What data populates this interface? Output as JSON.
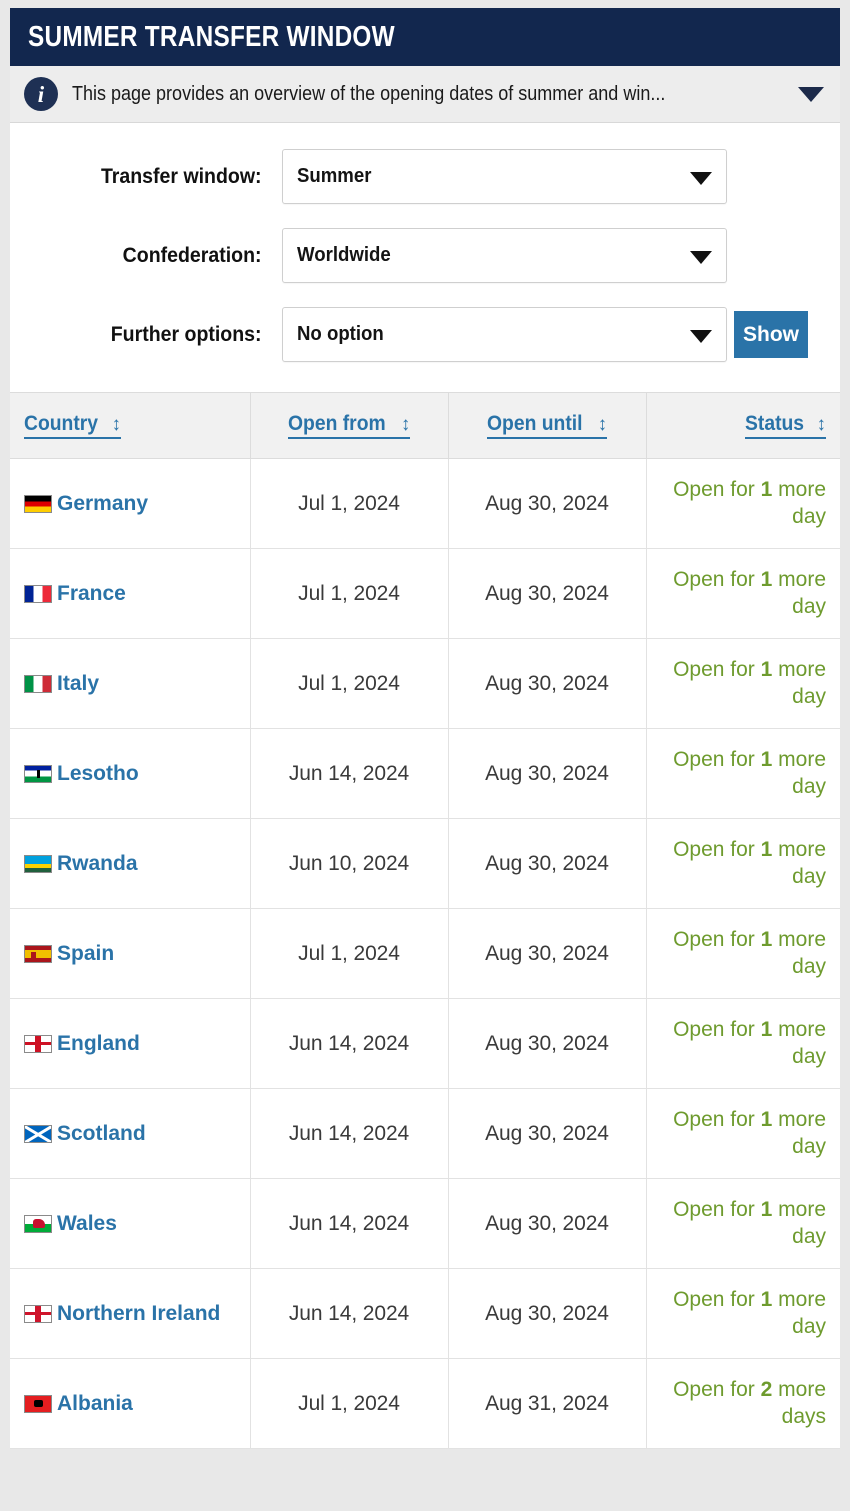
{
  "header": {
    "title": "SUMMER TRANSFER WINDOW"
  },
  "info_bar": {
    "icon": "info-icon",
    "text": "This page provides an overview of the opening dates of summer and win...",
    "expand_icon": "chevron-down-icon"
  },
  "filters": {
    "transfer_window": {
      "label": "Transfer window:",
      "value": "Summer"
    },
    "confederation": {
      "label": "Confederation:",
      "value": "Worldwide"
    },
    "further_options": {
      "label": "Further options:",
      "value": "No option"
    },
    "show_button": "Show"
  },
  "table": {
    "columns": [
      {
        "label": "Country",
        "sort_icon": "↕"
      },
      {
        "label": "Open from",
        "sort_icon": "↕"
      },
      {
        "label": "Open until",
        "sort_icon": "↕"
      },
      {
        "label": "Status",
        "sort_icon": "↕"
      }
    ],
    "rows": [
      {
        "country": "Germany",
        "flag": "f-de",
        "open_from": "Jul 1, 2024",
        "open_until": "Aug 30, 2024",
        "status_prefix": "Open for ",
        "status_count": "1",
        "status_suffix": " more day"
      },
      {
        "country": "France",
        "flag": "f-fr",
        "open_from": "Jul 1, 2024",
        "open_until": "Aug 30, 2024",
        "status_prefix": "Open for ",
        "status_count": "1",
        "status_suffix": " more day"
      },
      {
        "country": "Italy",
        "flag": "f-it",
        "open_from": "Jul 1, 2024",
        "open_until": "Aug 30, 2024",
        "status_prefix": "Open for ",
        "status_count": "1",
        "status_suffix": " more day"
      },
      {
        "country": "Lesotho",
        "flag": "f-ls",
        "open_from": "Jun 14, 2024",
        "open_until": "Aug 30, 2024",
        "status_prefix": "Open for ",
        "status_count": "1",
        "status_suffix": " more day"
      },
      {
        "country": "Rwanda",
        "flag": "f-rw",
        "open_from": "Jun 10, 2024",
        "open_until": "Aug 30, 2024",
        "status_prefix": "Open for ",
        "status_count": "1",
        "status_suffix": " more day"
      },
      {
        "country": "Spain",
        "flag": "f-es",
        "open_from": "Jul 1, 2024",
        "open_until": "Aug 30, 2024",
        "status_prefix": "Open for ",
        "status_count": "1",
        "status_suffix": " more day"
      },
      {
        "country": "England",
        "flag": "f-en",
        "open_from": "Jun 14, 2024",
        "open_until": "Aug 30, 2024",
        "status_prefix": "Open for ",
        "status_count": "1",
        "status_suffix": " more day"
      },
      {
        "country": "Scotland",
        "flag": "f-sc",
        "open_from": "Jun 14, 2024",
        "open_until": "Aug 30, 2024",
        "status_prefix": "Open for ",
        "status_count": "1",
        "status_suffix": " more day"
      },
      {
        "country": "Wales",
        "flag": "f-wa",
        "open_from": "Jun 14, 2024",
        "open_until": "Aug 30, 2024",
        "status_prefix": "Open for ",
        "status_count": "1",
        "status_suffix": " more day"
      },
      {
        "country": "Northern Ireland",
        "flag": "f-ni",
        "open_from": "Jun 14, 2024",
        "open_until": "Aug 30, 2024",
        "status_prefix": "Open for ",
        "status_count": "1",
        "status_suffix": " more day"
      },
      {
        "country": "Albania",
        "flag": "f-al",
        "open_from": "Jul 1, 2024",
        "open_until": "Aug 31, 2024",
        "status_prefix": "Open for ",
        "status_count": "2",
        "status_suffix": " more days"
      }
    ]
  },
  "colors": {
    "header_bg": "#12274E",
    "link_blue": "#2A73A8",
    "status_green": "#6E9B2E",
    "page_bg": "#E8E8E8"
  }
}
